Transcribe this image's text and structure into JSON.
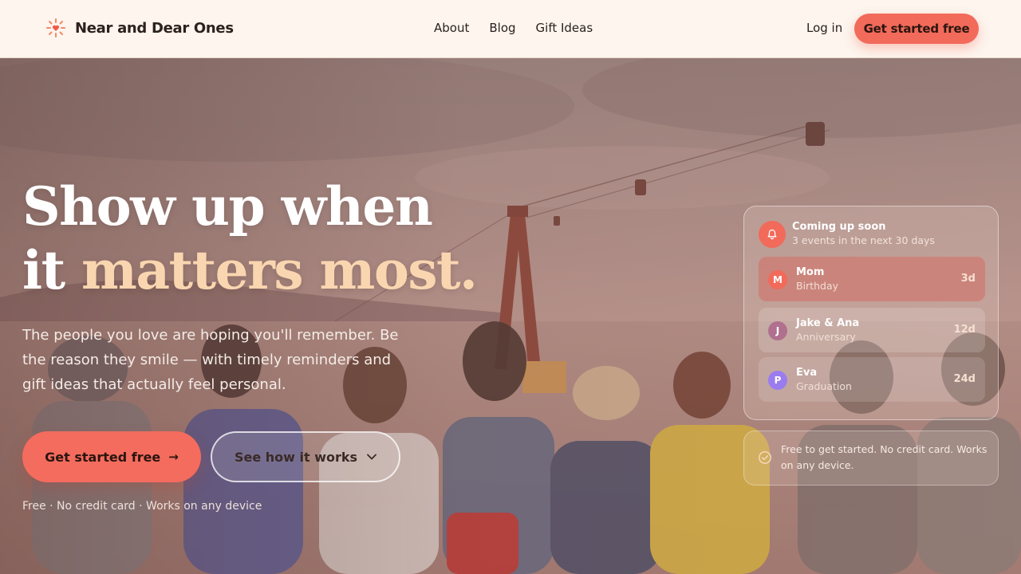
{
  "header": {
    "brand": "Near and Dear Ones",
    "nav": [
      "About",
      "Blog",
      "Gift Ideas"
    ],
    "login": "Log in",
    "cta": "Get started free"
  },
  "hero": {
    "headline_line1": "Show up when",
    "headline_line2_plain": "it",
    "headline_line2_accent": "matters most.",
    "subtext": "The people you love are hoping you'll remember. Be the reason they smile — with timely reminders and gift ideas that actually feel personal.",
    "primary_cta": "Get started free",
    "secondary_cta": "See how it works",
    "fine_print": "Free · No credit card · Works on any device"
  },
  "upcoming": {
    "title": "Coming up soon",
    "subtitle": "3 events in the next 30 days",
    "events": [
      {
        "initial": "M",
        "name": "Mom",
        "type": "Birthday",
        "days": "3d",
        "color": "#f26a5a"
      },
      {
        "initial": "J",
        "name": "Jake & Ana",
        "type": "Anniversary",
        "days": "12d",
        "color": "#b0708e"
      },
      {
        "initial": "P",
        "name": "Eva",
        "type": "Graduation",
        "days": "24d",
        "color": "#9b7cf0"
      }
    ]
  },
  "info": {
    "text": "Free to get started. No credit card. Works on any device."
  },
  "colors": {
    "accent": "#f26a5a",
    "header_bg": "#fdf5ee",
    "headline_accent": "#fad6b0"
  }
}
